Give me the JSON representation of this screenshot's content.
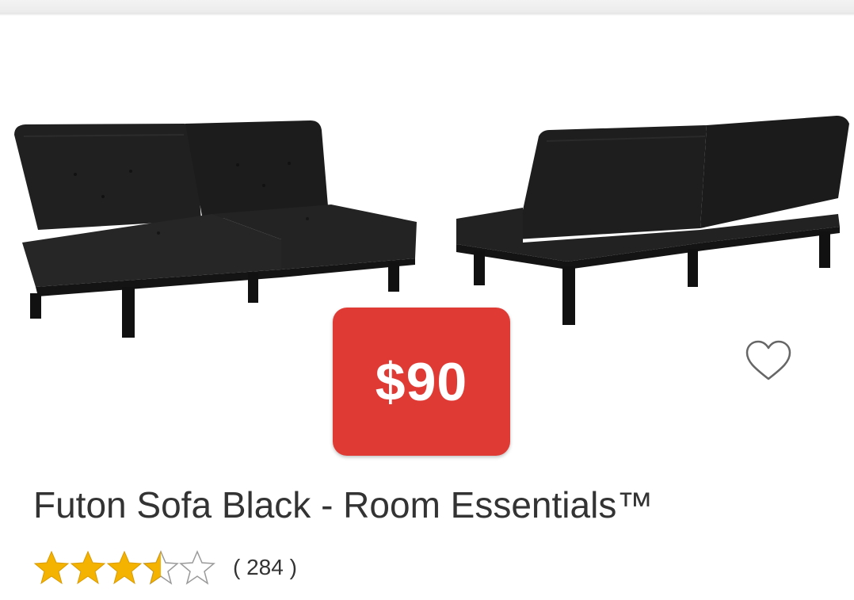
{
  "product": {
    "image_alt": "Futon sofa shown upright and reclined",
    "price": "$90",
    "title": "Futon Sofa Black - Room Essentials™",
    "rating": 3.5,
    "rating_max": 5,
    "review_count_text": "( 284 )"
  },
  "icons": {
    "favorite": "heart-outline-icon",
    "star_full": "star-filled-icon",
    "star_half": "star-half-icon",
    "star_empty": "star-outline-icon"
  },
  "colors": {
    "price_badge": "#e03a35",
    "star": "#f5b301",
    "star_outline": "#9a9a9a",
    "text": "#333333",
    "sofa": "#1e1e1e"
  }
}
